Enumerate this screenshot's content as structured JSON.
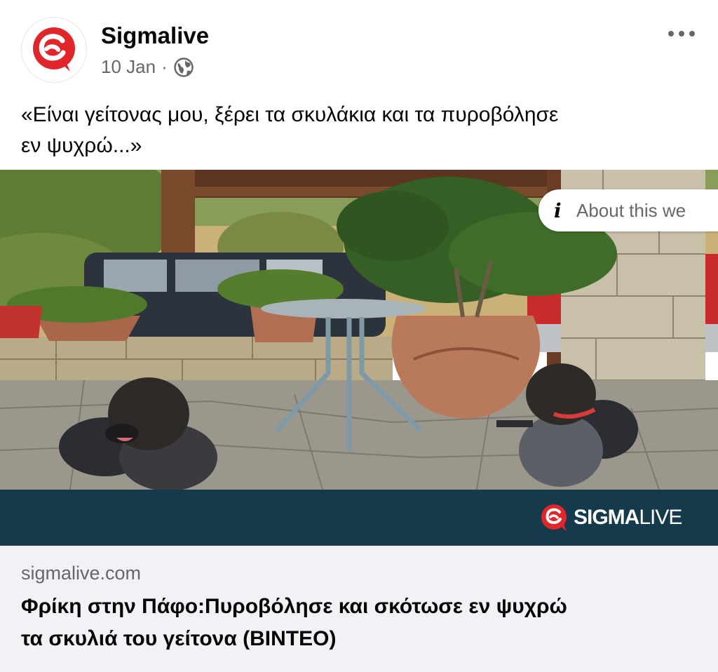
{
  "post": {
    "page_name": "Sigmalive",
    "date": "10 Jan",
    "separator": "·",
    "audience_icon": "globe-icon",
    "more_icon": "more-options-icon",
    "caption_line1": "«Είναι γείτονας μου, ξέρει τα σκυλάκια και τα πυροβόλησε",
    "caption_line2": "εν ψυχρώ...»"
  },
  "media": {
    "about_label": "About this we",
    "info_icon": "i",
    "brand_prefix": "SIGMA",
    "brand_suffix": "LIVE"
  },
  "link": {
    "domain": "sigmalive.com",
    "headline_line1": "Φρίκη στην Πάφο:Πυροβόλησε και σκότωσε εν ψυχρώ",
    "headline_line2": "τα σκυλιά του γείτονα (ΒΙΝΤΕΟ)"
  },
  "colors": {
    "brand_red": "#e0262b",
    "brand_band": "#153a4b",
    "secondary_text": "#65676b",
    "link_box_bg": "#f0f2f5"
  }
}
